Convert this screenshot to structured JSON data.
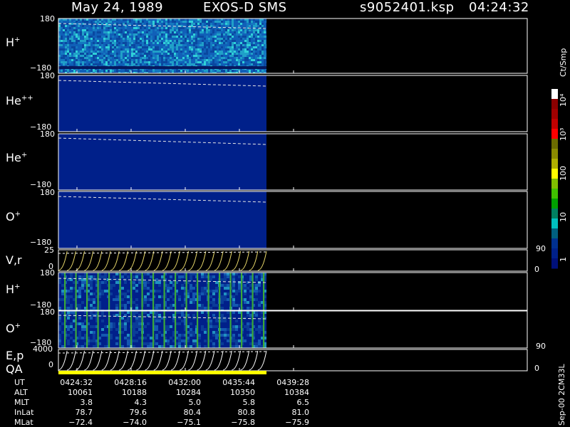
{
  "header": {
    "date": "May 24, 1989",
    "instrument": "EXOS-D SMS",
    "filename": "s9052401.ksp",
    "time": "04:24:32"
  },
  "panels": [
    {
      "key": "p1",
      "species": "H",
      "charge": "+",
      "top_tick": "180",
      "bottom_tick": "−180"
    },
    {
      "key": "p2",
      "species": "He",
      "charge": "++",
      "top_tick": "180",
      "bottom_tick": "−180"
    },
    {
      "key": "p3",
      "species": "He",
      "charge": "+",
      "top_tick": "180",
      "bottom_tick": "−180"
    },
    {
      "key": "p4",
      "species": "O",
      "charge": "+",
      "top_tick": "180",
      "bottom_tick": "−180"
    },
    {
      "key": "p5",
      "species": "V,r",
      "charge": "",
      "top_tick": "25",
      "bottom_tick": "0",
      "right_top": "90",
      "right_bottom": "0"
    },
    {
      "key": "p6",
      "species": "H",
      "charge": "+",
      "top_tick": "180",
      "bottom_tick": "−180"
    },
    {
      "key": "p7",
      "species": "O",
      "charge": "+",
      "top_tick": "180",
      "bottom_tick": "−180"
    },
    {
      "key": "p8",
      "species": "E,p",
      "species2": "QA",
      "charge": "",
      "top_tick": "4000",
      "bottom_tick": "0",
      "right_top": "90",
      "right_bottom": "0"
    }
  ],
  "colorbar": {
    "unit": "Ct/Smp",
    "labels": [
      "10⁴",
      "10³",
      "100",
      "10",
      "1"
    ],
    "colors": [
      "#ffffff",
      "#8b0000",
      "#a00000",
      "#c00000",
      "#ff0000",
      "#6b6b00",
      "#8b8b00",
      "#b0b000",
      "#ffff00",
      "#80c000",
      "#40c000",
      "#00a000",
      "#008060",
      "#00c0c0",
      "#006080",
      "#003090",
      "#00208a",
      "#00107a"
    ]
  },
  "footer_note": "Sep-00  2CM33L",
  "ephemeris": {
    "labels": [
      "UT",
      "ALT",
      "MLT",
      "InLat",
      "MLat"
    ],
    "columns": [
      {
        "UT": "0424:32",
        "ALT": "10061",
        "MLT": "3.8",
        "InLat": "78.7",
        "MLat": "−72.4"
      },
      {
        "UT": "0428:16",
        "ALT": "10188",
        "MLT": "4.3",
        "InLat": "79.6",
        "MLat": "−74.0"
      },
      {
        "UT": "0432:00",
        "ALT": "10284",
        "MLT": "5.0",
        "InLat": "80.4",
        "MLat": "−75.1"
      },
      {
        "UT": "0435:44",
        "ALT": "10350",
        "MLT": "5.8",
        "InLat": "80.8",
        "MLat": "−75.8"
      },
      {
        "UT": "0439:28",
        "ALT": "10384",
        "MLT": "6.5",
        "InLat": "81.0",
        "MLat": "−75.9"
      }
    ]
  },
  "chart_data": {
    "type": "heatmap",
    "title": "May 24, 1989   EXOS-D SMS",
    "x_tick_labels": [
      "0424:32",
      "0428:16",
      "0432:00",
      "0435:44",
      "0439:28"
    ],
    "data_coverage_fraction": 0.5,
    "panels": [
      {
        "name": "H+",
        "ylim": [
          -180,
          180
        ],
        "level": "high"
      },
      {
        "name": "He++",
        "ylim": [
          -180,
          180
        ],
        "level": "low"
      },
      {
        "name": "He+",
        "ylim": [
          -180,
          180
        ],
        "level": "low"
      },
      {
        "name": "O+",
        "ylim": [
          -180,
          180
        ],
        "level": "low"
      },
      {
        "name": "V,r",
        "ylim": [
          0,
          25
        ],
        "right_ylim": [
          0,
          90
        ]
      },
      {
        "name": "H+",
        "ylim": [
          -180,
          180
        ],
        "level": "medium"
      },
      {
        "name": "O+",
        "ylim": [
          -180,
          180
        ],
        "level": "medium"
      },
      {
        "name": "E,p",
        "ylim": [
          0,
          4000
        ],
        "right_ylim": [
          0,
          90
        ]
      }
    ],
    "colorbar_range": [
      1,
      10000
    ],
    "colorbar_scale": "log"
  }
}
